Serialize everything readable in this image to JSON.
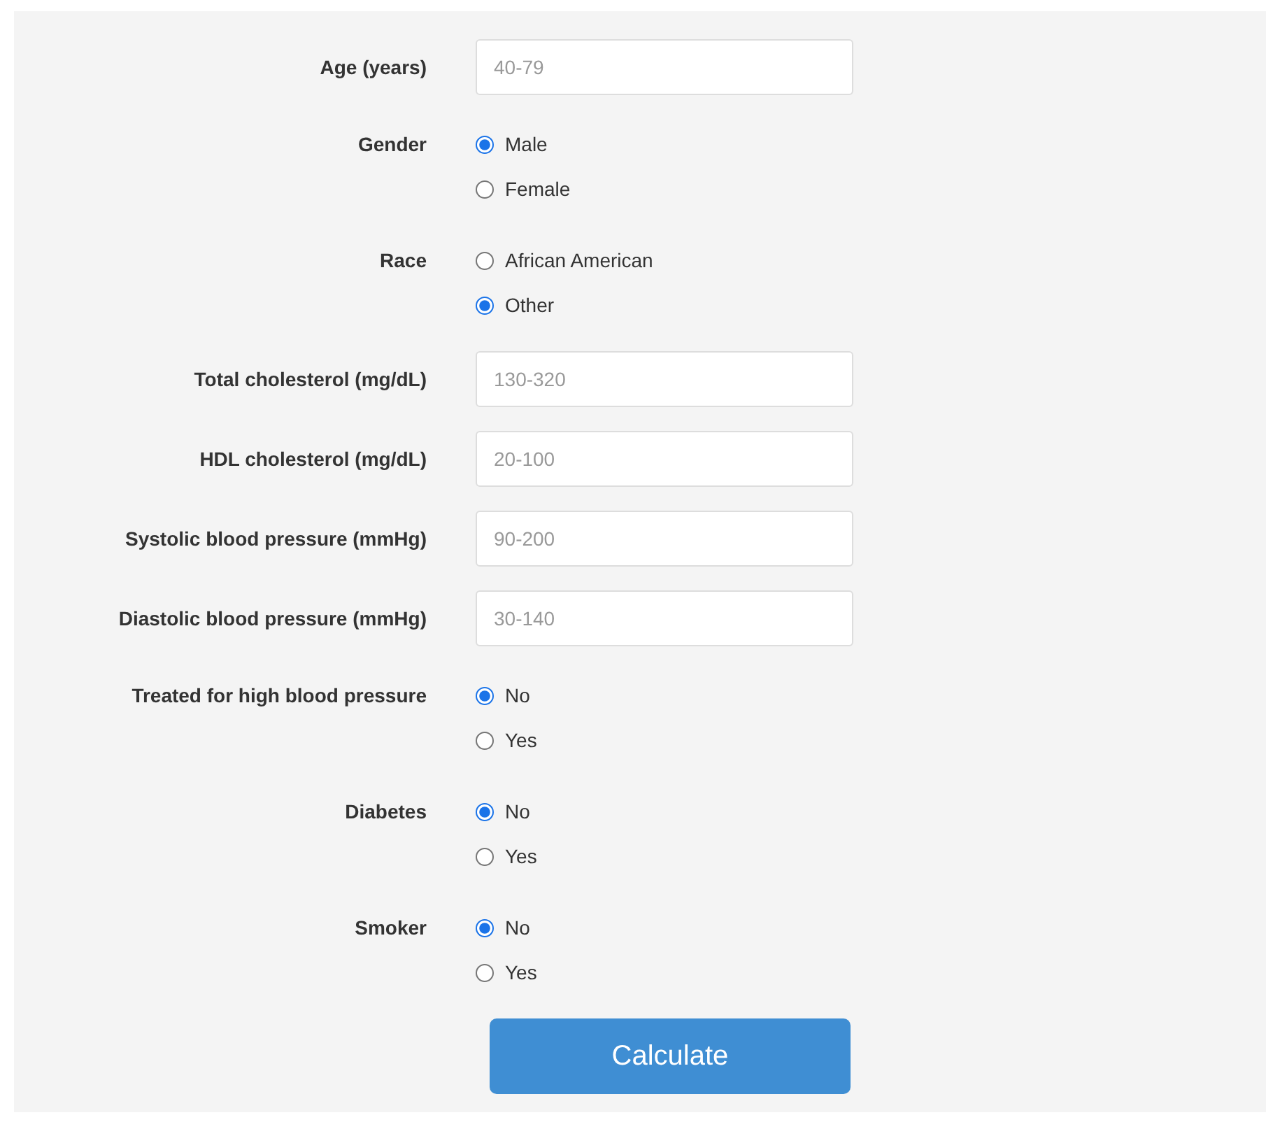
{
  "fields": [
    {
      "kind": "input",
      "label": "Age (years)",
      "placeholder": "40-79"
    },
    {
      "kind": "radio",
      "label": "Gender",
      "options": [
        {
          "label": "Male",
          "selected": true
        },
        {
          "label": "Female",
          "selected": false
        }
      ]
    },
    {
      "kind": "radio",
      "label": "Race",
      "options": [
        {
          "label": "African American",
          "selected": false
        },
        {
          "label": "Other",
          "selected": true
        }
      ]
    },
    {
      "kind": "input",
      "label": "Total cholesterol (mg/dL)",
      "placeholder": "130-320"
    },
    {
      "kind": "input",
      "label": "HDL cholesterol (mg/dL)",
      "placeholder": "20-100"
    },
    {
      "kind": "input",
      "label": "Systolic blood pressure (mmHg)",
      "placeholder": "90-200"
    },
    {
      "kind": "input",
      "label": "Diastolic blood pressure (mmHg)",
      "placeholder": "30-140"
    },
    {
      "kind": "radio",
      "label": "Treated for high blood pressure",
      "options": [
        {
          "label": "No",
          "selected": true
        },
        {
          "label": "Yes",
          "selected": false
        }
      ]
    },
    {
      "kind": "radio",
      "label": "Diabetes",
      "options": [
        {
          "label": "No",
          "selected": true
        },
        {
          "label": "Yes",
          "selected": false
        }
      ]
    },
    {
      "kind": "radio",
      "label": "Smoker",
      "options": [
        {
          "label": "No",
          "selected": true
        },
        {
          "label": "Yes",
          "selected": false
        }
      ]
    }
  ],
  "button": "Calculate"
}
